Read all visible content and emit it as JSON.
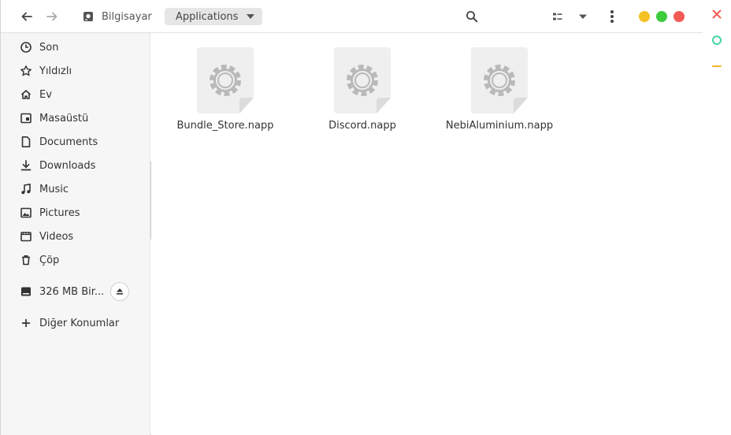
{
  "header": {
    "location_home": "Bilgisayar",
    "location_current": "Applications",
    "icons": {
      "back": "back-arrow-icon",
      "forward": "forward-arrow-icon",
      "search": "search-icon",
      "view": "list-view-icon",
      "view_options": "chevron-down-icon",
      "menu": "menu-dots-icon"
    },
    "window_controls": {
      "minimize_color": "#f5c024",
      "maximize_color": "#3ecb3e",
      "close_color": "#f25b55"
    }
  },
  "sidebar": {
    "items": [
      {
        "label": "Son",
        "icon": "clock-icon"
      },
      {
        "label": "Yıldızlı",
        "icon": "star-icon"
      },
      {
        "label": "Ev",
        "icon": "home-icon"
      },
      {
        "label": "Masaüstü",
        "icon": "desktop-icon"
      },
      {
        "label": "Documents",
        "icon": "document-icon"
      },
      {
        "label": "Downloads",
        "icon": "download-icon"
      },
      {
        "label": "Music",
        "icon": "music-icon"
      },
      {
        "label": "Pictures",
        "icon": "picture-icon"
      },
      {
        "label": "Videos",
        "icon": "video-icon"
      },
      {
        "label": "Çöp",
        "icon": "trash-icon"
      }
    ],
    "drive": {
      "label": "326 MB Bir...",
      "icon": "drive-icon",
      "eject_icon": "eject-icon"
    },
    "other": {
      "label": "Diğer Konumlar",
      "icon": "plus-icon"
    }
  },
  "files": [
    {
      "name": "Bundle_Store.napp",
      "icon": "executable-gear-icon"
    },
    {
      "name": "Discord.napp",
      "icon": "executable-gear-icon"
    },
    {
      "name": "NebiAluminium.napp",
      "icon": "executable-gear-icon"
    }
  ],
  "side_panel": {
    "close_color": "#f25b55",
    "maximize_color": "#43d6a3",
    "minimize_color": "#f0b429"
  }
}
